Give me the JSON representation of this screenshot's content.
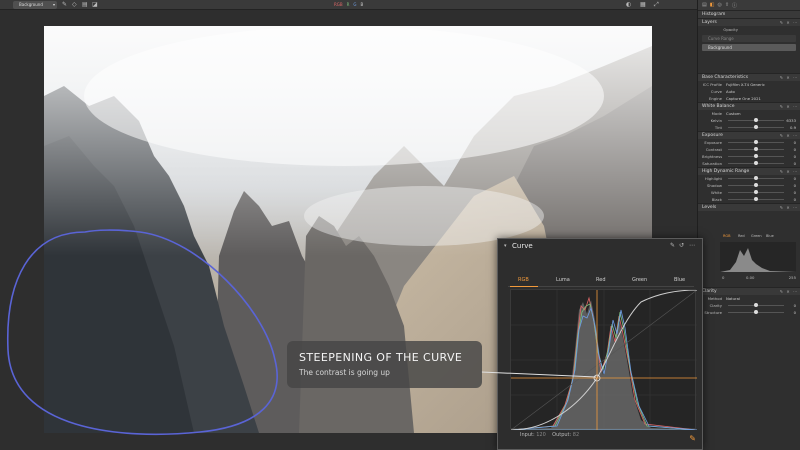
{
  "topbar": {
    "layer_select": "Background",
    "center_marks": [
      "RGB",
      "R",
      "G",
      "B"
    ]
  },
  "right_panel": {
    "tab_active": "Histogram",
    "layers": {
      "title": "Layers",
      "opacity_label": "Opacity",
      "layer_item": "Curve Range",
      "background_item": "Background"
    },
    "base_characteristics": {
      "title": "Base Characteristics",
      "rows": [
        {
          "label": "ICC Profile",
          "value": "Fujifilm X-T4 Generic"
        },
        {
          "label": "Curve",
          "value": "Auto"
        },
        {
          "label": "Engine",
          "value": "Capture One 2021"
        }
      ]
    },
    "white_balance": {
      "title": "White Balance",
      "mode_label": "Mode",
      "mode_value": "Custom",
      "rows": [
        {
          "label": "Kelvin",
          "num": "6333"
        },
        {
          "label": "Tint",
          "num": "0.9"
        }
      ]
    },
    "exposure": {
      "title": "Exposure",
      "rows": [
        {
          "label": "Exposure",
          "num": "0"
        },
        {
          "label": "Contrast",
          "num": "0"
        },
        {
          "label": "Brightness",
          "num": "0"
        },
        {
          "label": "Saturation",
          "num": "0"
        }
      ]
    },
    "hdr": {
      "title": "High Dynamic Range",
      "rows": [
        {
          "label": "Highlight",
          "num": "0"
        },
        {
          "label": "Shadow",
          "num": "0"
        },
        {
          "label": "White",
          "num": "0"
        },
        {
          "label": "Black",
          "num": "0"
        }
      ]
    },
    "levels": {
      "title": "Levels",
      "tabs": [
        "RGB",
        "Red",
        "Green",
        "Blue"
      ],
      "left_val": "0",
      "mid_val": "0.00",
      "right_val": "255"
    },
    "clarity": {
      "title": "Clarity",
      "method_label": "Method",
      "method_value": "Natural",
      "rows": [
        {
          "label": "Clarity",
          "num": "0"
        },
        {
          "label": "Structure",
          "num": "0"
        }
      ]
    }
  },
  "curve_panel": {
    "title": "Curve",
    "tabs": [
      "RGB",
      "Luma",
      "Red",
      "Green",
      "Blue"
    ],
    "active_tab": "RGB",
    "input_label": "Input:",
    "input_value": "120",
    "output_label": "Output:",
    "output_value": "82",
    "accent_color": "#f29a3b"
  },
  "annotation": {
    "title": "STEEPENING OF THE CURVE",
    "subtitle": "The contrast is going up"
  },
  "colors": {
    "accent": "#f29a3b",
    "annotation_circle": "#5a64d6"
  }
}
